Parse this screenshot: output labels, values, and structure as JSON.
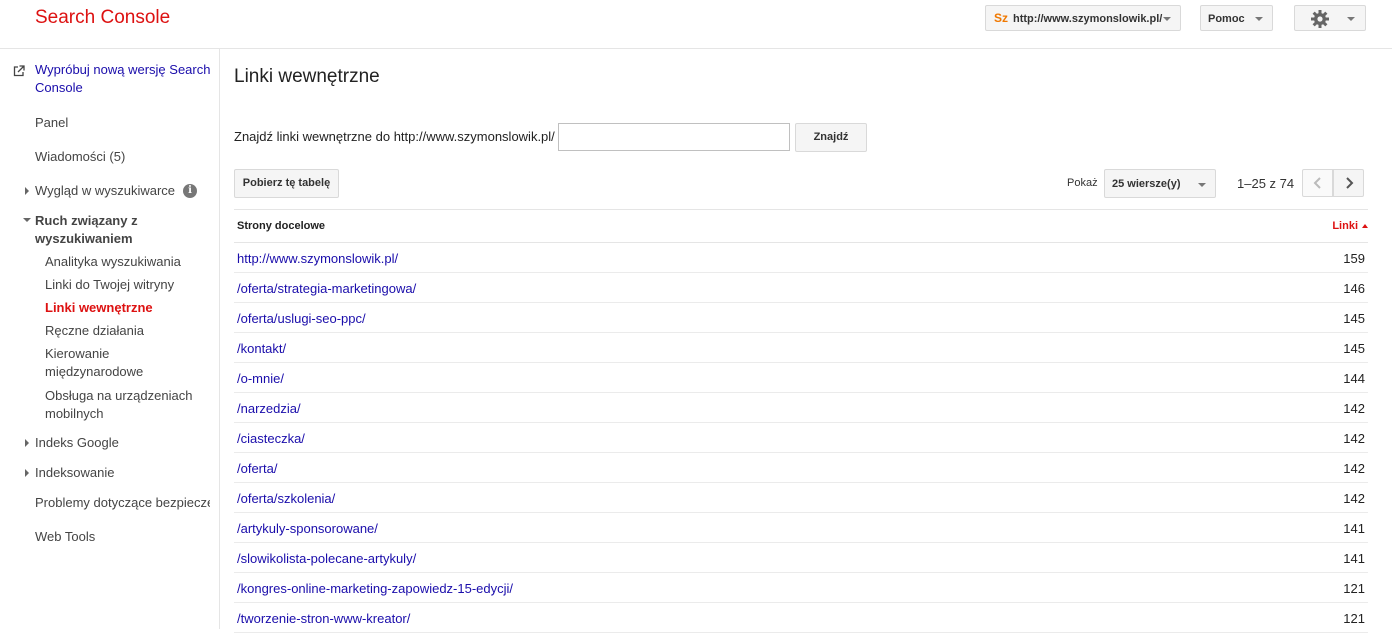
{
  "header": {
    "logo": "Search Console",
    "site": {
      "favicon_text": "Sz",
      "url": "http://www.szymonslowik.pl/"
    },
    "help_label": "Pomoc",
    "settings_icon": "gear-icon"
  },
  "sidebar": {
    "new_version": "Wypróbuj nową wersję Search Console",
    "panel": "Panel",
    "messages": "Wiadomości (5)",
    "appearance": "Wygląd w wyszukiwarce",
    "traffic": "Ruch związany z wyszukiwaniem",
    "traffic_items": [
      "Analityka wyszukiwania",
      "Linki do Twojej witryny",
      "Linki wewnętrzne",
      "Ręczne działania",
      "Kierowanie międzynarodowe",
      "Obsługa na urządzeniach mobilnych"
    ],
    "google_index": "Indeks Google",
    "crawl": "Indeksowanie",
    "security": "Problemy dotyczące bezpieczeństwa",
    "web_tools": "Web Tools"
  },
  "main": {
    "title": "Linki wewnętrzne",
    "find_label": "Znajdź linki wewnętrzne do http://www.szymonslowik.pl/",
    "find_input_value": "",
    "find_button": "Znajdź",
    "download_button": "Pobierz tę tabelę",
    "show_label": "Pokaż",
    "rows_option": "25 wiersze(y)",
    "range": "1–25 z 74",
    "col_pages": "Strony docelowe",
    "col_links": "Linki",
    "rows": [
      {
        "url": "http://www.szymonslowik.pl/",
        "links": "159"
      },
      {
        "url": "/oferta/strategia-marketingowa/",
        "links": "146"
      },
      {
        "url": "/oferta/uslugi-seo-ppc/",
        "links": "145"
      },
      {
        "url": "/kontakt/",
        "links": "145"
      },
      {
        "url": "/o-mnie/",
        "links": "144"
      },
      {
        "url": "/narzedzia/",
        "links": "142"
      },
      {
        "url": "/ciasteczka/",
        "links": "142"
      },
      {
        "url": "/oferta/",
        "links": "142"
      },
      {
        "url": "/oferta/szkolenia/",
        "links": "142"
      },
      {
        "url": "/artykuly-sponsorowane/",
        "links": "141"
      },
      {
        "url": "/slowikolista-polecane-artykuly/",
        "links": "141"
      },
      {
        "url": "/kongres-online-marketing-zapowiedz-15-edycji/",
        "links": "121"
      },
      {
        "url": "/tworzenie-stron-www-kreator/",
        "links": "121"
      }
    ]
  },
  "colors": {
    "brand_red": "#dd1111",
    "link_blue": "#1a0dab"
  }
}
